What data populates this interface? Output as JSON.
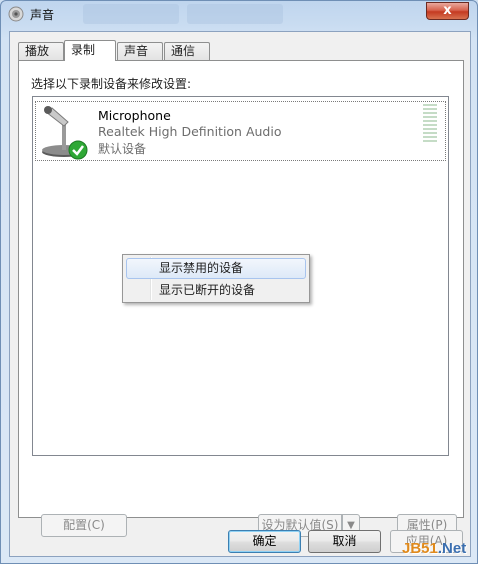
{
  "window": {
    "title": "声音",
    "close_glyph": "x",
    "title_icon": "speaker-icon"
  },
  "tabs": [
    {
      "label": "播放",
      "active": false
    },
    {
      "label": "录制",
      "active": true
    },
    {
      "label": "声音",
      "active": false
    },
    {
      "label": "通信",
      "active": false
    }
  ],
  "panel": {
    "instruction": "选择以下录制设备来修改设置:"
  },
  "devices": [
    {
      "name": "Microphone",
      "description": "Realtek High Definition Audio",
      "status": "默认设备",
      "icon": "microphone-icon",
      "badge_icon": "green-check-icon",
      "level": 0
    }
  ],
  "context_menu": {
    "items": [
      {
        "label": "显示禁用的设备",
        "highlighted": true
      },
      {
        "label": "显示已断开的设备",
        "highlighted": false
      }
    ]
  },
  "panel_buttons": {
    "configure": "配置(C)",
    "set_default": "设为默认值(S)",
    "properties": "属性(P)"
  },
  "dialog_buttons": {
    "ok": "确定",
    "cancel": "取消",
    "apply": "应用(A)"
  },
  "watermark": {
    "text_a": "JB51",
    "text_b": ".Net"
  },
  "colors": {
    "accent": "#3c7fb1",
    "close_red": "#c43a22",
    "check_green": "#2fa836"
  }
}
